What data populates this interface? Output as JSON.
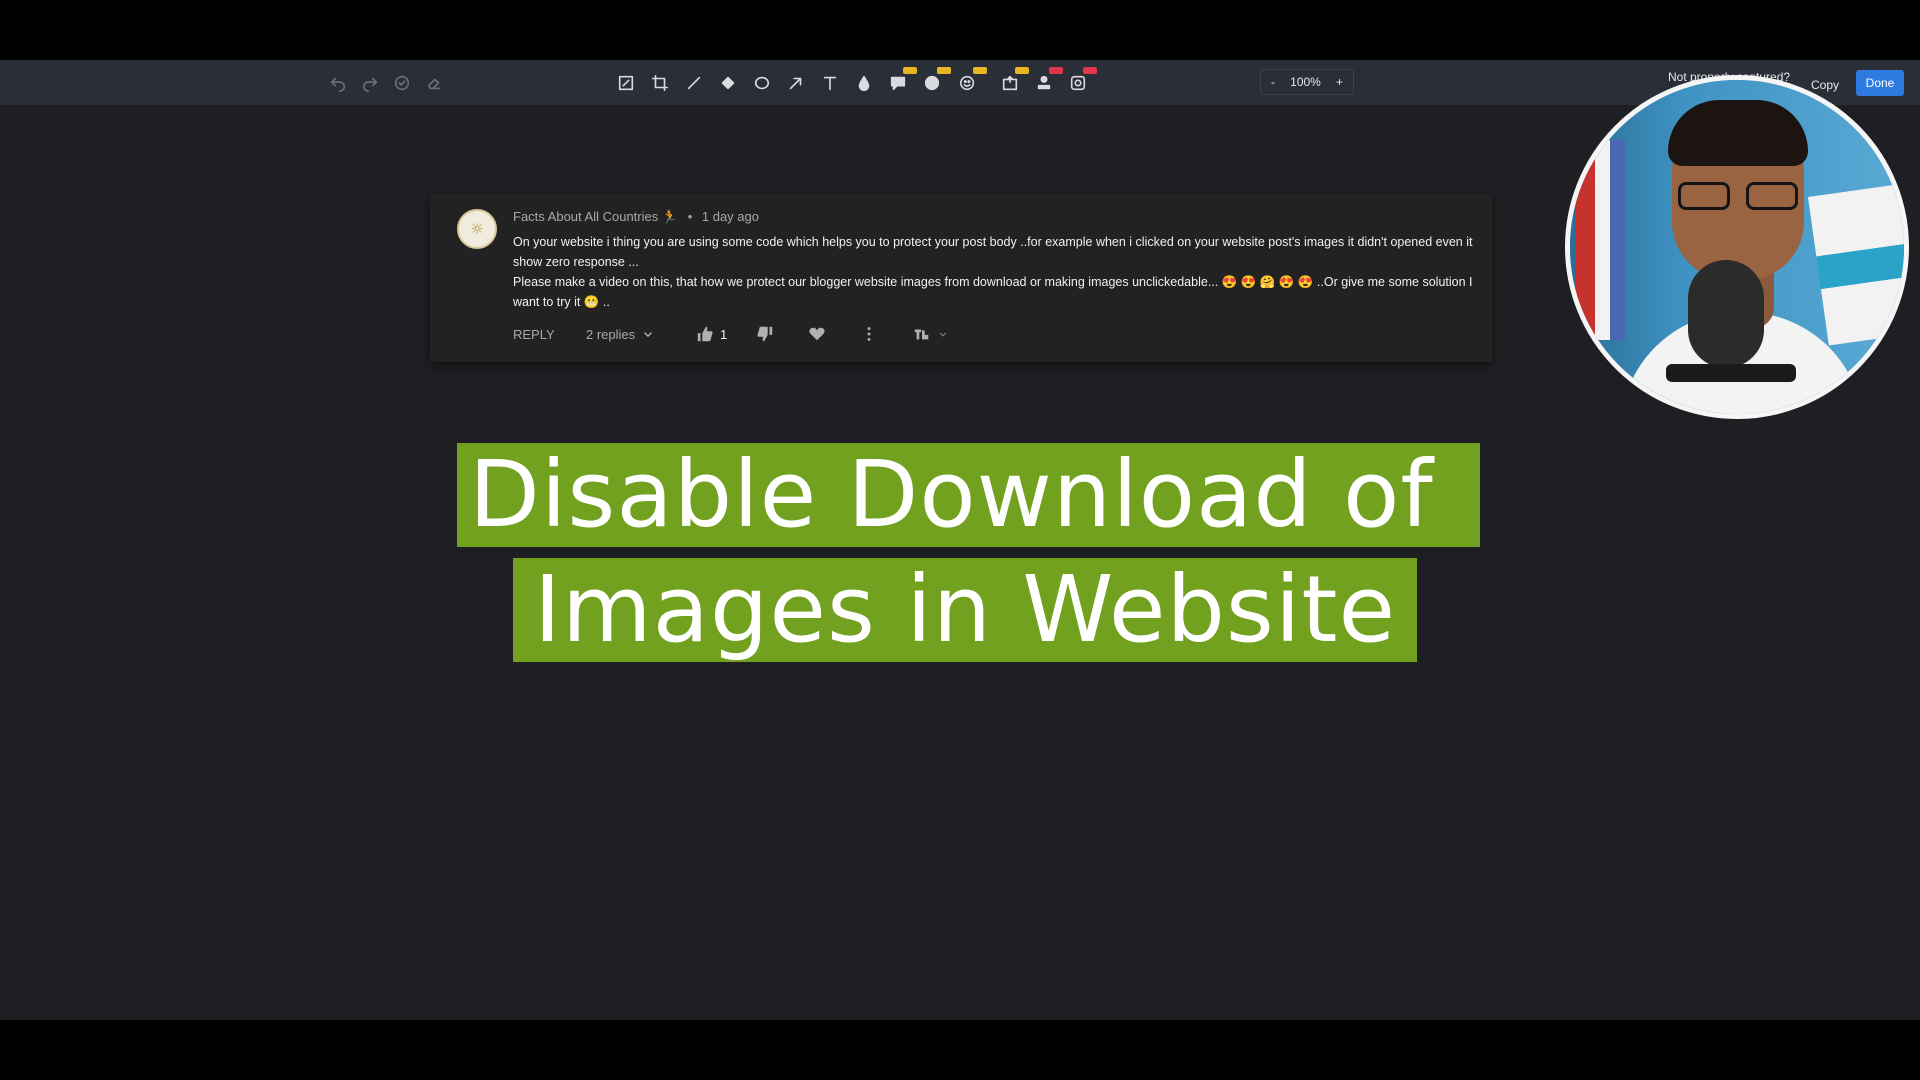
{
  "toolbar": {
    "left_icons": [
      "undo-icon",
      "redo-icon",
      "reset-icon",
      "eraser-icon"
    ],
    "tool_icons": [
      "frame-icon",
      "crop-icon",
      "line-icon",
      "fill-icon",
      "ellipse-icon",
      "arrow-icon",
      "text-icon",
      "blur-icon",
      "callout-icon",
      "step-icon",
      "emoji-icon",
      "sticker-icon",
      "stamp-icon",
      "screenshot-icon"
    ],
    "pro_badge_color": "#e8b523",
    "new_badge_color": "#e2364d",
    "zoom": {
      "minus": "-",
      "value": "100%",
      "plus": "+"
    },
    "not_captured": "Not properly captured?",
    "copy_label": "Copy",
    "done_label": "Done",
    "done_color": "#2d7be0"
  },
  "comment": {
    "author": "Facts About All Countries",
    "separator": "•",
    "time": "1 day ago",
    "line1": "On your website i thing you are using some code which helps you to protect your post body ..for example when i clicked on your website post's images it didn't opened even it show zero response ...",
    "line2": "Please make a video on this, that how we protect our blogger website images from download or making images unclickedable... 😍 😍 🤗 😍 😍 ..Or give me some solution I want to try it 😬 ..",
    "reply_label": "REPLY",
    "replies_label": "2 replies",
    "like_count": "1"
  },
  "headline": {
    "line1": "Disable Download of",
    "line2": "Images in Website",
    "highlight_color": "#72a120"
  }
}
